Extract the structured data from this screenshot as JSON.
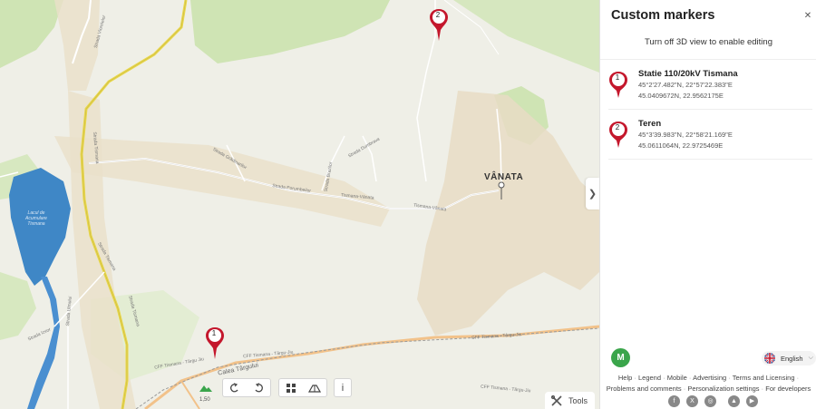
{
  "map": {
    "village_label": "VÂNATA",
    "road_labels": [
      "Strada Viorelelor",
      "Strada Grădinarilor",
      "Tismana-Vânata",
      "Calea Târgului",
      "Strada Tismana",
      "Strada Izvor",
      "Strada Ulmului",
      "Strada Porumbeilor",
      "Strada Brazilor",
      "Strada Dumbrava",
      "Strada Nucului",
      "Lacul de Acumulare Tismana",
      "CFF Tismana - Târgu Jiu",
      "CFF Tismana - Târgu-Jiu"
    ],
    "markers": [
      {
        "number": "1"
      },
      {
        "number": "2"
      }
    ],
    "scale_label": "1,50",
    "info_icon": "i",
    "tools_label": "Tools",
    "controls": {
      "terrain_icon": "terrain-icon",
      "rotate_left_icon": "rotate-left-icon",
      "rotate_right_icon": "rotate-right-icon",
      "grid_icon": "grid-icon",
      "tilt_icon": "tilt-icon"
    },
    "collapse_arrow": "❯"
  },
  "panel": {
    "title": "Custom markers",
    "close_icon": "✕",
    "notice": "Turn off 3D view to enable editing",
    "items": [
      {
        "number": "1",
        "name": "Statie 110/20kV Tismana",
        "dms": "45°2'27.482\"N, 22°57'22.383\"E",
        "decimal": "45.0409672N, 22.9562175E"
      },
      {
        "number": "2",
        "name": "Teren",
        "dms": "45°3'39.983\"N, 22°58'21.169\"E",
        "decimal": "45.0611064N, 22.9725469E"
      }
    ],
    "avatar_letter": "M",
    "language": "English",
    "footer_line1": [
      "Help",
      "Legend",
      "Mobile",
      "Advertising",
      "Terms and Licensing"
    ],
    "footer_line2": [
      "Problems and comments",
      "Personalization settings",
      "For developers"
    ],
    "socials": [
      "f",
      "X",
      "◎",
      "▲",
      "▶"
    ]
  },
  "colors": {
    "marker_red": "#c4172c",
    "green_area": "#cfe4b4",
    "water": "#3f87c6",
    "road_yellow": "#e9d84a",
    "avatar_green": "#3aa54b"
  }
}
